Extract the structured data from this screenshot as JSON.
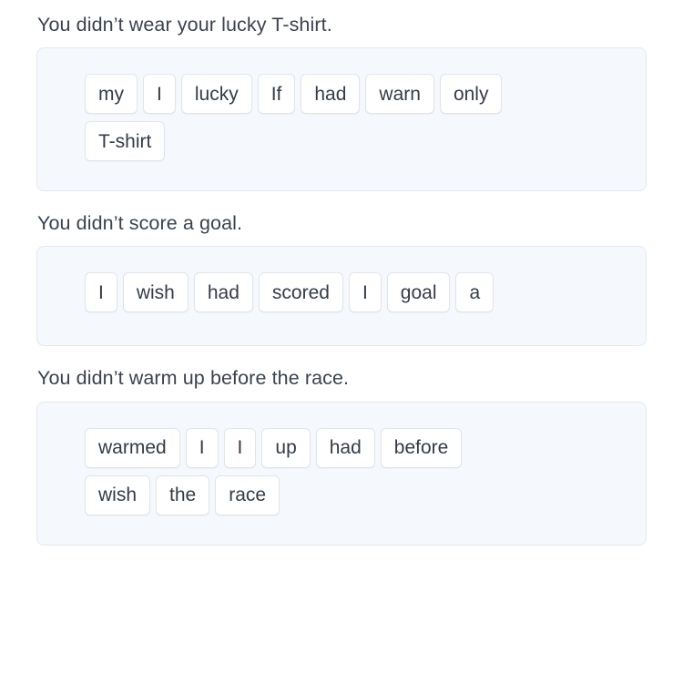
{
  "page": {
    "background_color": "#ffffff",
    "panel_background_color": "#f5f8fc",
    "panel_border_color": "#e3e8ef",
    "chip_background_color": "#ffffff",
    "chip_border_color": "#e0e5ec",
    "prompt_text_color": "#3b434f",
    "chip_text_color": "#343c48"
  },
  "questions": [
    {
      "prompt": "You didn’t wear your lucky T-shirt.",
      "word_bank_rows": [
        [
          "my",
          "I",
          "lucky",
          "If",
          "had",
          "warn",
          "only"
        ],
        [
          "T-shirt"
        ]
      ]
    },
    {
      "prompt": "You didn’t score a goal.",
      "word_bank_rows": [
        [
          "I",
          "wish",
          "had",
          "scored",
          "I",
          "goal",
          "a"
        ]
      ]
    },
    {
      "prompt": "You didn’t warm up before the race.",
      "word_bank_rows": [
        [
          "warmed",
          "I",
          "I",
          "up",
          "had",
          "before"
        ],
        [
          "wish",
          "the",
          "race"
        ]
      ]
    }
  ]
}
